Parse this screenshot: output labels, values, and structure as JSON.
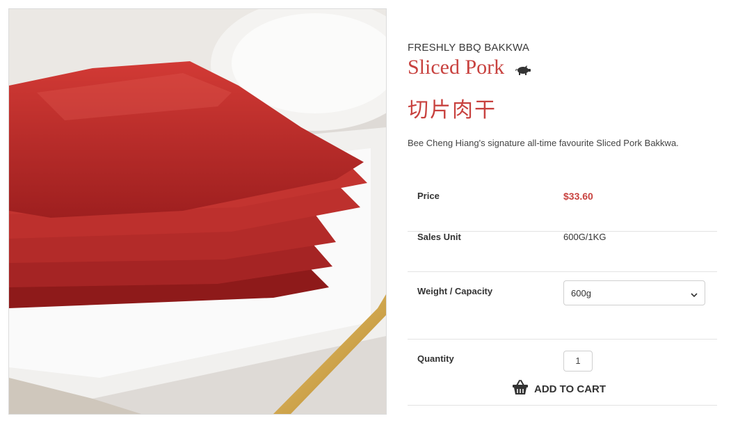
{
  "product": {
    "category": "FRESHLY BBQ BAKKWA",
    "name": "Sliced Pork",
    "name_chinese": "切片肉干",
    "description": "Bee Cheng Hiang's signature all-time favourite Sliced Pork Bakkwa.",
    "icon": "pig-icon"
  },
  "specs": {
    "price_label": "Price",
    "price_value": "$33.60",
    "unit_label": "Sales Unit",
    "unit_value": "600G/1KG",
    "weight_label": "Weight / Capacity",
    "weight_selected": "600g",
    "quantity_label": "Quantity",
    "quantity_value": "1"
  },
  "actions": {
    "add_to_cart": "ADD TO CART",
    "cart_icon": "basket-icon"
  },
  "colors": {
    "accent": "#c8423f",
    "text": "#333333",
    "divider": "#e3e3e3"
  }
}
